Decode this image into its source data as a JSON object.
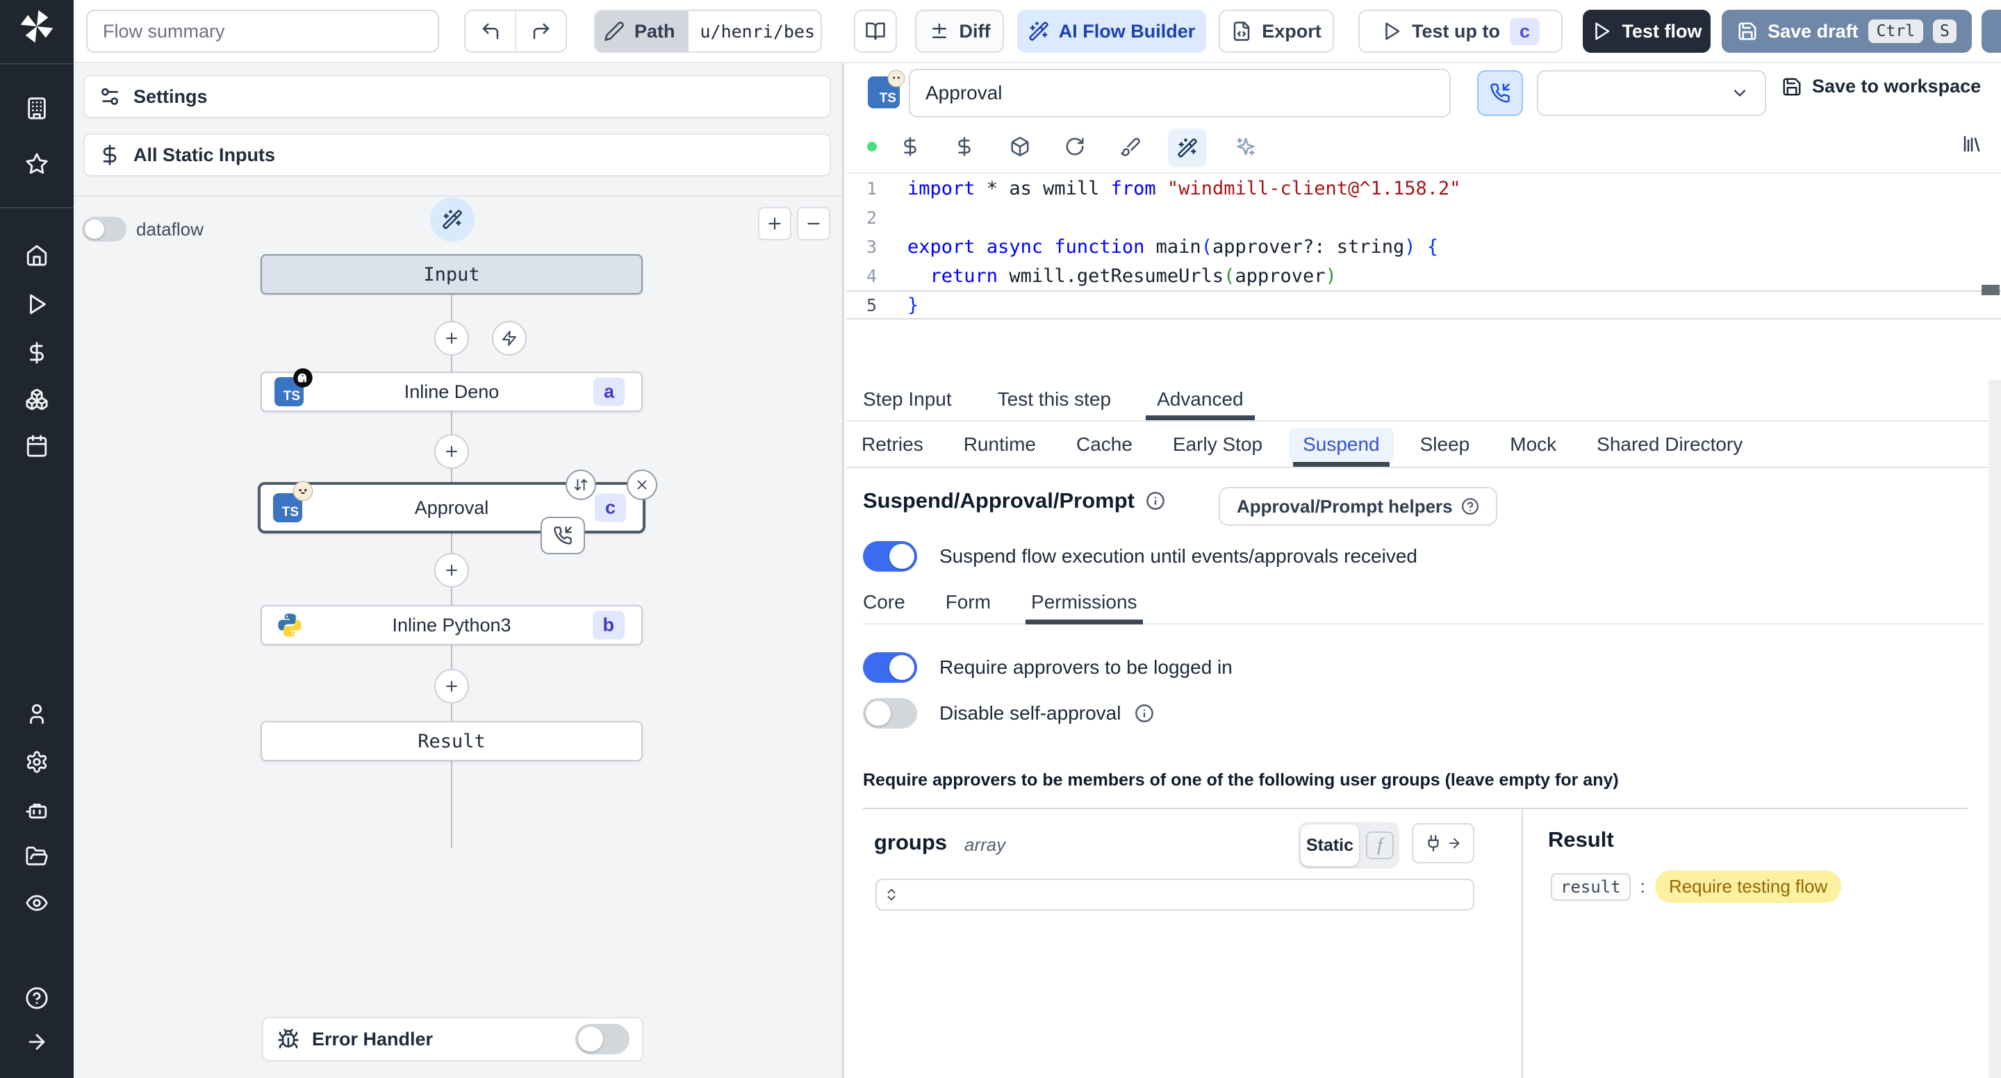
{
  "colors": {
    "accent_blue": "#3b6cf0",
    "badge_bg": "#e0e7ff",
    "badge_text": "#4338ca",
    "selected_tab_blue": "#3352cf",
    "result_highlight_bg": "#fcf0a3",
    "result_highlight_text": "#946800",
    "ai_button_bg": "#dbeafe",
    "save_draft_bg": "#7088a7",
    "dark_button_bg": "#242b38"
  },
  "topbar": {
    "flow_summary_placeholder": "Flow summary",
    "path_label": "Path",
    "path_value": "u/henri/bes",
    "diff_label": "Diff",
    "ai_builder_label": "AI Flow Builder",
    "export_label": "Export",
    "test_up_to_label": "Test up to",
    "test_up_to_badge": "c",
    "test_flow_label": "Test flow",
    "save_draft_label": "Save draft",
    "save_draft_keys": [
      "Ctrl",
      "S"
    ]
  },
  "flow_panel": {
    "settings_label": "Settings",
    "static_inputs_label": "All Static Inputs",
    "dataflow_label": "dataflow",
    "dataflow_on": false,
    "nodes": {
      "input": "Input",
      "deno": {
        "title": "Inline Deno",
        "badge": "a"
      },
      "approval": {
        "title": "Approval",
        "badge": "c"
      },
      "python": {
        "title": "Inline Python3",
        "badge": "b"
      },
      "result": "Result"
    },
    "error_handler": {
      "label": "Error Handler",
      "on": false
    }
  },
  "editor": {
    "title_value": "Approval",
    "save_to_workspace": "Save to workspace",
    "code": {
      "lines": [
        {
          "n": "1",
          "tokens": [
            {
              "t": "import",
              "c": "kw"
            },
            {
              "t": " * as wmill ",
              "c": "pl"
            },
            {
              "t": "from",
              "c": "kw"
            },
            {
              "t": " ",
              "c": "pl"
            },
            {
              "t": "\"windmill-client@^1.158.2\"",
              "c": "str"
            }
          ]
        },
        {
          "n": "2",
          "tokens": []
        },
        {
          "n": "3",
          "tokens": [
            {
              "t": "export",
              "c": "kw"
            },
            {
              "t": " ",
              "c": "pl"
            },
            {
              "t": "async",
              "c": "kw"
            },
            {
              "t": " ",
              "c": "pl"
            },
            {
              "t": "function",
              "c": "kw"
            },
            {
              "t": " main",
              "c": "pl"
            },
            {
              "t": "(",
              "c": "p1"
            },
            {
              "t": "approver?: string",
              "c": "pl"
            },
            {
              "t": ")",
              "c": "p1"
            },
            {
              "t": " ",
              "c": "pl"
            },
            {
              "t": "{",
              "c": "p1"
            }
          ]
        },
        {
          "n": "4",
          "tokens": [
            {
              "t": "  ",
              "c": "pl"
            },
            {
              "t": "return",
              "c": "kw"
            },
            {
              "t": " wmill.getResumeUrls",
              "c": "pl"
            },
            {
              "t": "(",
              "c": "p2"
            },
            {
              "t": "approver",
              "c": "pl"
            },
            {
              "t": ")",
              "c": "p2"
            }
          ]
        },
        {
          "n": "5",
          "active": true,
          "tokens": [
            {
              "t": "}",
              "c": "p1"
            }
          ]
        }
      ]
    }
  },
  "step_panel": {
    "tabs": [
      "Step Input",
      "Test this step",
      "Advanced"
    ],
    "subtabs": [
      "Retries",
      "Runtime",
      "Cache",
      "Early Stop",
      "Suspend",
      "Sleep",
      "Mock",
      "Shared Directory"
    ],
    "suspend": {
      "heading": "Suspend/Approval/Prompt",
      "helpers_button": "Approval/Prompt helpers",
      "suspend_toggle": {
        "label": "Suspend flow execution until events/approvals received",
        "on": true
      },
      "perm_tabs": [
        "Core",
        "Form",
        "Permissions"
      ],
      "require_login": {
        "label": "Require approvers to be logged in",
        "on": true
      },
      "disable_self": {
        "label": "Disable self-approval",
        "on": false
      },
      "groups_note": "Require approvers to be members of one of the following user groups (leave empty for any)",
      "groups": {
        "name": "groups",
        "type": "array",
        "static_label": "Static"
      },
      "result": {
        "title": "Result",
        "key": "result",
        "value": "Require testing flow"
      }
    }
  }
}
